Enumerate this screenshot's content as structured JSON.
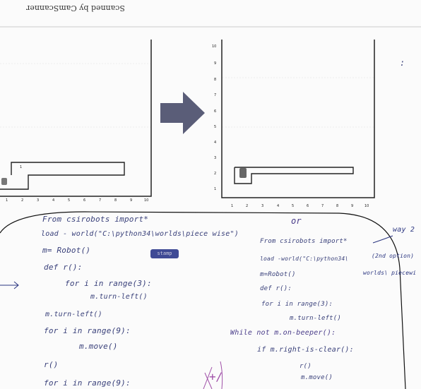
{
  "footer": {
    "scanned_text": "Scanned by CamScanner"
  },
  "arrow": {
    "color": "#5a5d78"
  },
  "left_grid": {
    "x_ticks": [
      "1",
      "2",
      "3",
      "4",
      "5",
      "6",
      "7",
      "8",
      "9",
      "10"
    ],
    "robot_label": "1"
  },
  "right_grid": {
    "x_ticks": [
      "1",
      "2",
      "3",
      "4",
      "5",
      "6",
      "7",
      "8",
      "9",
      "10"
    ],
    "y_ticks": [
      "1",
      "2",
      "3",
      "4",
      "5",
      "6",
      "7",
      "8",
      "9",
      "10"
    ],
    "robot_label": "1"
  },
  "side_mark": ":",
  "code_left": [
    "From csirobots import*",
    "load - world(\"C:\\python34\\worlds\\piece wise\")",
    "m= Robot()",
    "def r():",
    "for i in range(3):",
    "m.turn-left()",
    "m.turn-left()",
    "for i in range(9):",
    "m.move()",
    "r()",
    "for i in range(9):"
  ],
  "or_label": "or",
  "code_right": [
    "From csirobots import*",
    "load -world(\"C:\\python34\\",
    "m=Robot()",
    "def r():",
    "for i in range(3):",
    "m.turn-left()",
    "While not m.on-beeper():",
    "if m.right-is-clear():",
    "r()",
    "m.move()"
  ],
  "annotations": {
    "way2": "way 2",
    "second_option": "(2nd option)",
    "worlds_piecewise": "worlds\\ piecewi"
  },
  "stamp": "stamp",
  "marks": {
    "tick_mark": "+/"
  }
}
